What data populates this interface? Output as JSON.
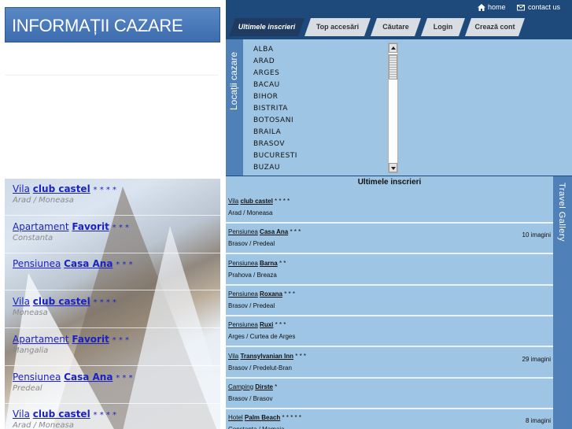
{
  "header": {
    "logo_text": "INFORMAȚII CAZARE",
    "home_label": "home",
    "contact_label": "contact us"
  },
  "nav": {
    "tabs": [
      {
        "label": "Ultimele inscrieri",
        "active": true
      },
      {
        "label": "Top accesări",
        "active": false
      },
      {
        "label": "Căutare",
        "active": false
      },
      {
        "label": "Login",
        "active": false
      },
      {
        "label": "Crează cont",
        "active": false
      }
    ]
  },
  "locatii": {
    "title": "Locații cazare",
    "counties": [
      "ALBA",
      "ARAD",
      "ARGES",
      "BACAU",
      "BIHOR",
      "BISTRITA",
      "BOTOSANI",
      "BRAILA",
      "BRASOV",
      "BUCURESTI",
      "BUZAU"
    ]
  },
  "left_listings": [
    {
      "type": "Vila",
      "name": "club castel",
      "stars": "* * * *",
      "location": "Arad / Moneasa"
    },
    {
      "type": "Apartament",
      "name": "Favorit",
      "stars": "* * *",
      "location": "Constanta"
    },
    {
      "type": "Pensiunea",
      "name": "Casa Ana",
      "stars": "* * *",
      "location": ""
    },
    {
      "type": "Vila",
      "name": "club castel",
      "stars": "* * * *",
      "location": "Moneasa"
    },
    {
      "type": "Apartament",
      "name": "Favorit",
      "stars": "* * *",
      "location": "Mangalia"
    },
    {
      "type": "Pensiunea",
      "name": "Casa Ana",
      "stars": "* * *",
      "location": "Predeal"
    },
    {
      "type": "Vila",
      "name": "club castel",
      "stars": "* * * *",
      "location": "Arad / Moneasa"
    }
  ],
  "ultimele": {
    "title": "Ultimele inscrieri",
    "entries": [
      {
        "type": "Vila",
        "name": "club castel",
        "stars": "* * * *",
        "location": "Arad / Moneasa",
        "images": ""
      },
      {
        "type": "Pensiunea",
        "name": "Casa Ana",
        "stars": "* * *",
        "location": "Brasov / Predeal",
        "images": "10 imagini"
      },
      {
        "type": "Pensiunea",
        "name": "Barna",
        "stars": "* *",
        "location": "Prahova / Breaza",
        "images": ""
      },
      {
        "type": "Pensiunea",
        "name": "Roxana",
        "stars": "* * *",
        "location": "Brasov / Predeal",
        "images": ""
      },
      {
        "type": "Pensiunea",
        "name": "Ruxi",
        "stars": "* * *",
        "location": "Arges / Curtea de Arges",
        "images": ""
      },
      {
        "type": "Vila",
        "name": "Transylvanian Inn",
        "stars": "* * *",
        "location": "Brasov / Predelut-Bran",
        "images": "29 imagini"
      },
      {
        "type": "Camping",
        "name": "Dirste",
        "stars": "*",
        "location": "Brasov / Brasov",
        "images": ""
      },
      {
        "type": "Hotel",
        "name": "Palm Beach",
        "stars": "* * * * *",
        "location": "Constanta / Mamaia",
        "images": "8 imagini"
      }
    ]
  },
  "travel_gallery": {
    "label": "Travel Gallery"
  }
}
